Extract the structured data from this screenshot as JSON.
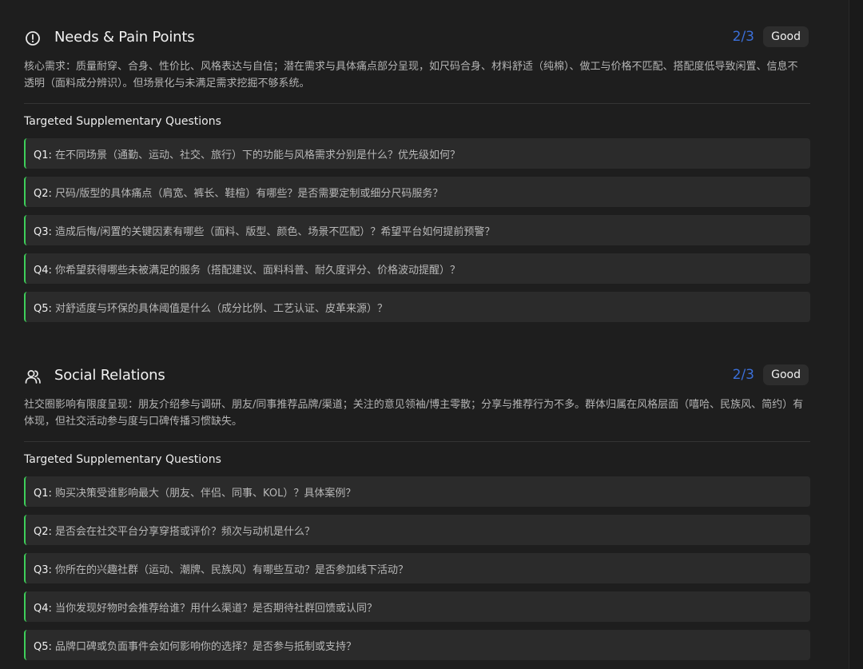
{
  "sections": [
    {
      "icon": "alert-circle-icon",
      "title": "Needs & Pain Points",
      "score": "2/3",
      "rating": "Good",
      "summary": "核心需求：质量耐穿、合身、性价比、风格表达与自信；潜在需求与具体痛点部分呈现，如尺码合身、材料舒适（纯棉）、做工与价格不匹配、搭配度低导致闲置、信息不透明（面料成分辨识）。但场景化与未满足需求挖掘不够系统。",
      "questions_heading": "Targeted Supplementary Questions",
      "questions": [
        {
          "label": "Q1:",
          "text": "在不同场景（通勤、运动、社交、旅行）下的功能与风格需求分别是什么？优先级如何？"
        },
        {
          "label": "Q2:",
          "text": "尺码/版型的具体痛点（肩宽、裤长、鞋楦）有哪些？是否需要定制或细分尺码服务？"
        },
        {
          "label": "Q3:",
          "text": "造成后悔/闲置的关键因素有哪些（面料、版型、颜色、场景不匹配）？希望平台如何提前预警？"
        },
        {
          "label": "Q4:",
          "text": "你希望获得哪些未被满足的服务（搭配建议、面料科普、耐久度评分、价格波动提醒）？"
        },
        {
          "label": "Q5:",
          "text": "对舒适度与环保的具体阈值是什么（成分比例、工艺认证、皮革来源）？"
        }
      ]
    },
    {
      "icon": "users-icon",
      "title": "Social Relations",
      "score": "2/3",
      "rating": "Good",
      "summary": "社交圈影响有限度呈现：朋友介绍参与调研、朋友/同事推荐品牌/渠道；关注的意见领袖/博主零散；分享与推荐行为不多。群体归属在风格层面（嘻哈、民族风、简约）有体现，但社交活动参与度与口碑传播习惯缺失。",
      "questions_heading": "Targeted Supplementary Questions",
      "questions": [
        {
          "label": "Q1:",
          "text": "购买决策受谁影响最大（朋友、伴侣、同事、KOL）？具体案例？"
        },
        {
          "label": "Q2:",
          "text": "是否会在社交平台分享穿搭或评价？频次与动机是什么？"
        },
        {
          "label": "Q3:",
          "text": "你所在的兴趣社群（运动、潮牌、民族风）有哪些互动？是否参加线下活动？"
        },
        {
          "label": "Q4:",
          "text": "当你发现好物时会推荐给谁？用什么渠道？是否期待社群回馈或认同？"
        },
        {
          "label": "Q5:",
          "text": "品牌口碑或负面事件会如何影响你的选择？是否参与抵制或支持？"
        }
      ]
    }
  ],
  "colors": {
    "background": "#1e1e1e",
    "accent_green": "#3ecf5a",
    "score_blue": "#3b6fd8"
  }
}
